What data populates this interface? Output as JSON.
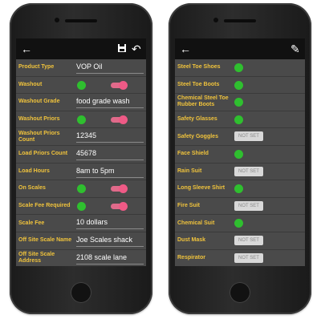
{
  "left": {
    "toolbar": {
      "back_icon": "arrow-left-icon",
      "save_icon": "floppy-save-icon",
      "undo_icon": "undo-icon"
    },
    "rows": [
      {
        "label": "Product Type",
        "type": "text",
        "value": "VOP Oil"
      },
      {
        "label": "Washout",
        "type": "toggle",
        "state": "on"
      },
      {
        "label": "Washout Grade",
        "type": "text",
        "value": "food grade wash"
      },
      {
        "label": "Washout Priors",
        "type": "toggle",
        "state": "on"
      },
      {
        "label": "Washout Priors Count",
        "type": "text",
        "value": "12345"
      },
      {
        "label": "Load Priors Count",
        "type": "text",
        "value": "45678"
      },
      {
        "label": "Load Hours",
        "type": "text",
        "value": "8am to 5pm"
      },
      {
        "label": "On Scales",
        "type": "toggle",
        "state": "on"
      },
      {
        "label": "Scale Fee Required",
        "type": "toggle",
        "state": "on"
      },
      {
        "label": "Scale Fee",
        "type": "text",
        "value": "10 dollars"
      },
      {
        "label": "Off Site Scale Name",
        "type": "text",
        "value": "Joe Scales shack"
      },
      {
        "label": "Off Site Scale Address",
        "type": "text",
        "value": "2108 scale lane"
      }
    ]
  },
  "right": {
    "toolbar": {
      "back_icon": "arrow-left-icon",
      "edit_icon": "pencil-edit-icon"
    },
    "rows": [
      {
        "label": "Steel Toe Shoes",
        "status": "green"
      },
      {
        "label": "Steel Toe Boots",
        "status": "green"
      },
      {
        "label": "Chemical Steel Toe Rubber Boots",
        "status": "green"
      },
      {
        "label": "Safety Glasses",
        "status": "green"
      },
      {
        "label": "Safety Goggles",
        "status": "notset",
        "text": "NOT SET"
      },
      {
        "label": "Face Shield",
        "status": "green"
      },
      {
        "label": "Rain Suit",
        "status": "notset",
        "text": "NOT SET"
      },
      {
        "label": "Long Sleeve Shirt",
        "status": "green"
      },
      {
        "label": "Fire Suit",
        "status": "notset",
        "text": "NOT SET"
      },
      {
        "label": "Chemical Suit",
        "status": "green"
      },
      {
        "label": "Dust Mask",
        "status": "notset",
        "text": "NOT SET"
      },
      {
        "label": "Respirator",
        "status": "notset",
        "text": "NOT SET"
      }
    ]
  },
  "colors": {
    "label": "#f0c33c",
    "green": "#2fbf2f",
    "toggle": "#ef5a86",
    "screen_bg": "#4a4a4a",
    "topbar": "#111111"
  }
}
